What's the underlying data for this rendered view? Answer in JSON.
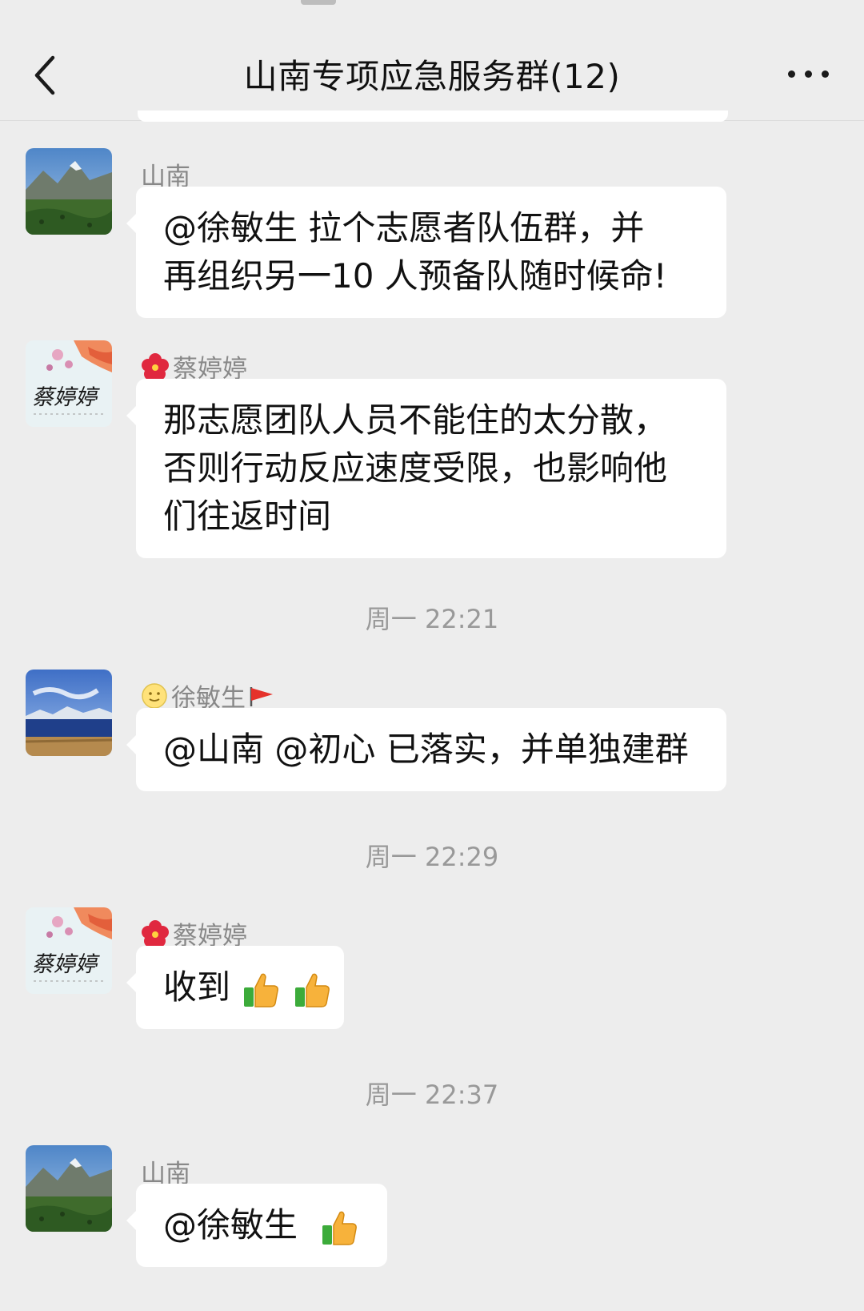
{
  "header": {
    "title": "山南专项应急服务群(12)",
    "back_icon": "chevron-left-icon",
    "more_icon": "more-dots-icon"
  },
  "messages": [
    {
      "sender": "山南",
      "avatar": "mountain-meadow-avatar",
      "lines": [
        "@徐敏生  拉个志愿者队伍群，并",
        "再组织另一10 人预备队随时候命!"
      ]
    },
    {
      "sender": "蔡婷婷",
      "sender_prefix_icon": "hibiscus-icon",
      "avatar": "calligraphy-avatar",
      "avatar_text": "蔡婷婷",
      "lines": [
        "那志愿团队人员不能住的太分散，",
        "否则行动反应速度受限，也影响他",
        "们往返时间"
      ]
    },
    {
      "time": "周一 22:21"
    },
    {
      "sender": "徐敏生",
      "sender_prefix_icon": "smiley-icon",
      "sender_suffix_icon": "red-flag-icon",
      "avatar": "lake-mountain-avatar",
      "lines": [
        "@山南 @初心 已落实，并单独建群"
      ]
    },
    {
      "time": "周一 22:29"
    },
    {
      "sender": "蔡婷婷",
      "sender_prefix_icon": "hibiscus-icon",
      "avatar": "calligraphy-avatar",
      "avatar_text": "蔡婷婷",
      "text": "收到",
      "trailing_icons": [
        "thumbs-up-icon",
        "thumbs-up-icon"
      ]
    },
    {
      "time": "周一 22:37"
    },
    {
      "sender": "山南",
      "avatar": "mountain-meadow-avatar",
      "text": "@徐敏生",
      "trailing_icons": [
        "thumbs-up-icon"
      ]
    }
  ],
  "colors": {
    "background": "#ededed",
    "bubble": "#ffffff",
    "sender_name": "#888888",
    "timestamp": "#999999"
  }
}
